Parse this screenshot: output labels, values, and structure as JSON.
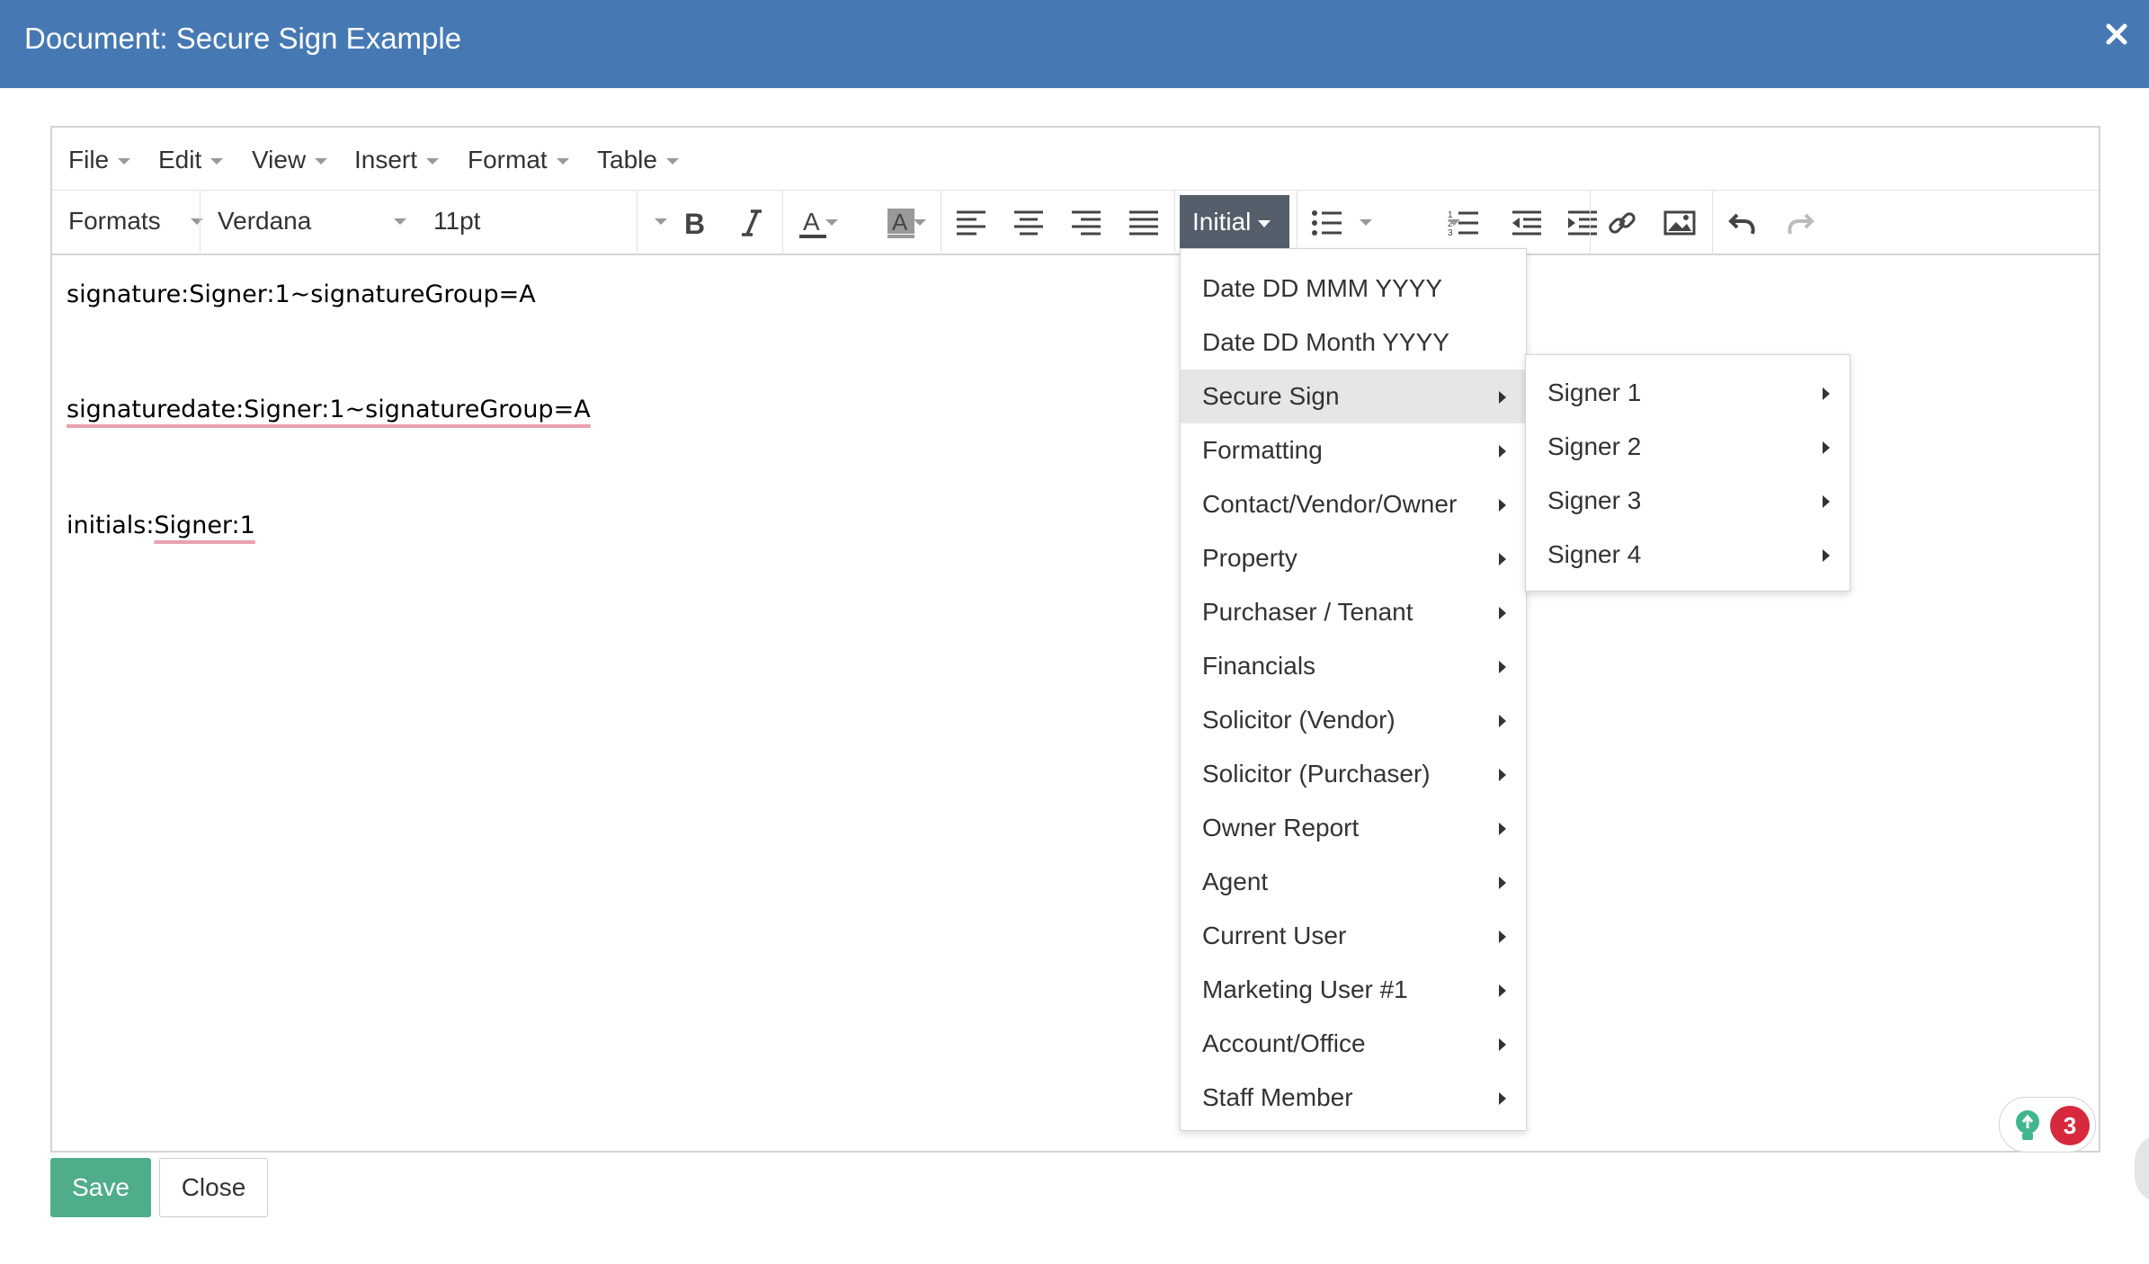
{
  "window": {
    "title": "Document: Secure Sign Example",
    "close_icon": "close-icon"
  },
  "menubar": {
    "items": [
      "File",
      "Edit",
      "View",
      "Insert",
      "Format",
      "Table"
    ]
  },
  "toolbar": {
    "formats_label": "Formats",
    "font_family": "Verdana",
    "font_size": "11pt",
    "initial_label": "Initial",
    "icons": [
      "bold-icon",
      "italic-icon",
      "text-color-icon",
      "background-color-icon",
      "align-left-icon",
      "align-center-icon",
      "align-right-icon",
      "align-justify-icon",
      "bullet-list-icon",
      "numbered-list-icon",
      "outdent-icon",
      "indent-icon",
      "link-icon",
      "image-icon",
      "undo-icon",
      "redo-icon"
    ]
  },
  "content": {
    "line1": "signature:Signer:1~signatureGroup=A",
    "line2": "signaturedate:Signer:1~signatureGroup=A",
    "line3_prefix": "initials:",
    "line3_suffix": "Signer:1"
  },
  "dropdown": {
    "items": [
      {
        "label": "Date DD MMM YYYY",
        "submenu": false
      },
      {
        "label": "Date DD Month YYYY",
        "submenu": false
      },
      {
        "label": "Secure Sign",
        "submenu": true,
        "active": true
      },
      {
        "label": "Formatting",
        "submenu": true
      },
      {
        "label": "Contact/Vendor/Owner",
        "submenu": true
      },
      {
        "label": "Property",
        "submenu": true
      },
      {
        "label": "Purchaser / Tenant",
        "submenu": true
      },
      {
        "label": "Financials",
        "submenu": true
      },
      {
        "label": "Solicitor (Vendor)",
        "submenu": true
      },
      {
        "label": "Solicitor (Purchaser)",
        "submenu": true
      },
      {
        "label": "Owner Report",
        "submenu": true
      },
      {
        "label": "Agent",
        "submenu": true
      },
      {
        "label": "Current User",
        "submenu": true
      },
      {
        "label": "Marketing User #1",
        "submenu": true
      },
      {
        "label": "Account/Office",
        "submenu": true
      },
      {
        "label": "Staff Member",
        "submenu": true
      }
    ]
  },
  "submenu": {
    "items": [
      "Signer 1",
      "Signer 2",
      "Signer 3",
      "Signer 4"
    ]
  },
  "footer": {
    "save_label": "Save",
    "close_label": "Close"
  },
  "help_widget": {
    "badge_count": "3",
    "icon": "lightbulb-icon"
  },
  "colors": {
    "titlebar": "#4679b3",
    "save_button": "#4fad8a",
    "initial_button": "#555e6b",
    "badge": "#d6293e"
  }
}
